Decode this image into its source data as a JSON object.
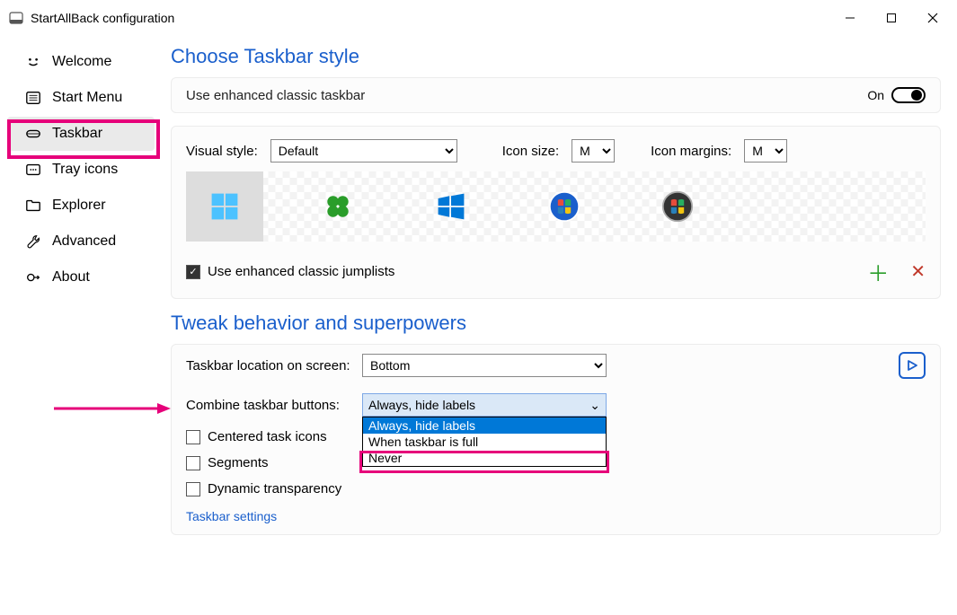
{
  "titlebar": {
    "title": "StartAllBack configuration"
  },
  "sidebar": {
    "items": [
      {
        "label": "Welcome"
      },
      {
        "label": "Start Menu"
      },
      {
        "label": "Taskbar"
      },
      {
        "label": "Tray icons"
      },
      {
        "label": "Explorer"
      },
      {
        "label": "Advanced"
      },
      {
        "label": "About"
      }
    ]
  },
  "section1": {
    "title": "Choose Taskbar style",
    "enhanced_label": "Use enhanced classic taskbar",
    "toggle_state": "On",
    "visual_style_label": "Visual style:",
    "visual_style_value": "Default",
    "icon_size_label": "Icon size:",
    "icon_size_value": "M",
    "icon_margins_label": "Icon margins:",
    "icon_margins_value": "M",
    "jumplists_label": "Use enhanced classic jumplists"
  },
  "section2": {
    "title": "Tweak behavior and superpowers",
    "location_label": "Taskbar location on screen:",
    "location_value": "Bottom",
    "combine_label": "Combine taskbar buttons:",
    "combine_value": "Always, hide labels",
    "combine_options": [
      "Always, hide labels",
      "When taskbar is full",
      "Never"
    ],
    "centered_label": "Centered task icons",
    "segments_label": "Segments",
    "dynamic_label": "Dynamic transparency",
    "settings_link": "Taskbar settings"
  }
}
